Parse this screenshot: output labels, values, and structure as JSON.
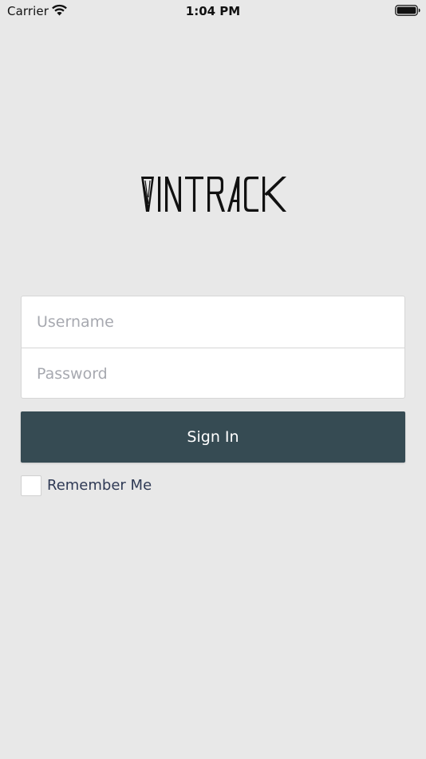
{
  "status_bar": {
    "carrier": "Carrier",
    "time": "1:04 PM",
    "wifi_icon": "wifi-icon",
    "battery_icon": "battery-icon"
  },
  "logo": {
    "text": "VINTRACK",
    "color": "#111111"
  },
  "login_form": {
    "username_placeholder": "Username",
    "username_value": "",
    "password_placeholder": "Password",
    "password_value": "",
    "signin_label": "Sign In",
    "remember_label": "Remember Me",
    "remember_checked": false
  },
  "colors": {
    "background": "#e8e8e8",
    "button": "#364b53",
    "label": "#2f3a55",
    "placeholder": "#a7a9b0"
  }
}
